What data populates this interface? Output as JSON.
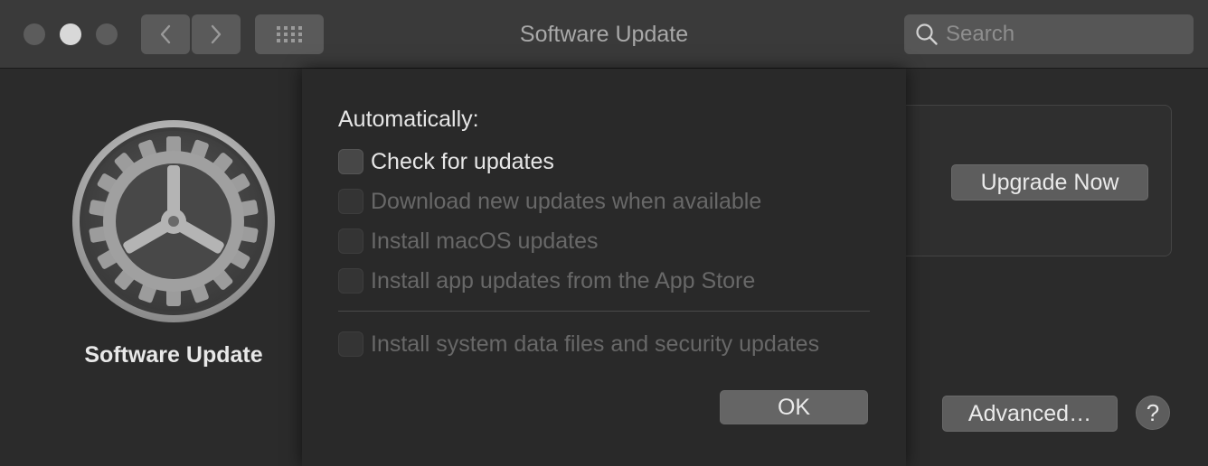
{
  "window": {
    "title": "Software Update"
  },
  "toolbar": {
    "back_icon": "chevron-left-icon",
    "forward_icon": "chevron-right-icon",
    "grid_icon": "grid-icon",
    "search_placeholder": "Search"
  },
  "sidebar": {
    "app_name": "Software Update",
    "app_icon": "gear-icon"
  },
  "main": {
    "upgrade_button": "Upgrade Now",
    "advanced_button": "Advanced…",
    "help_button": "?"
  },
  "sheet": {
    "heading": "Automatically:",
    "options": [
      {
        "label": "Check for updates",
        "checked": false,
        "enabled": true
      },
      {
        "label": "Download new updates when available",
        "checked": false,
        "enabled": false
      },
      {
        "label": "Install macOS updates",
        "checked": false,
        "enabled": false
      },
      {
        "label": "Install app updates from the App Store",
        "checked": false,
        "enabled": false
      },
      {
        "label": "Install system data files and security updates",
        "checked": false,
        "enabled": false
      }
    ],
    "ok_button": "OK"
  },
  "colors": {
    "window_bg": "#2b2b2b",
    "titlebar_bg": "#3a3a3a",
    "button_bg": "#5d5d5d",
    "disabled_text": "#686868"
  }
}
